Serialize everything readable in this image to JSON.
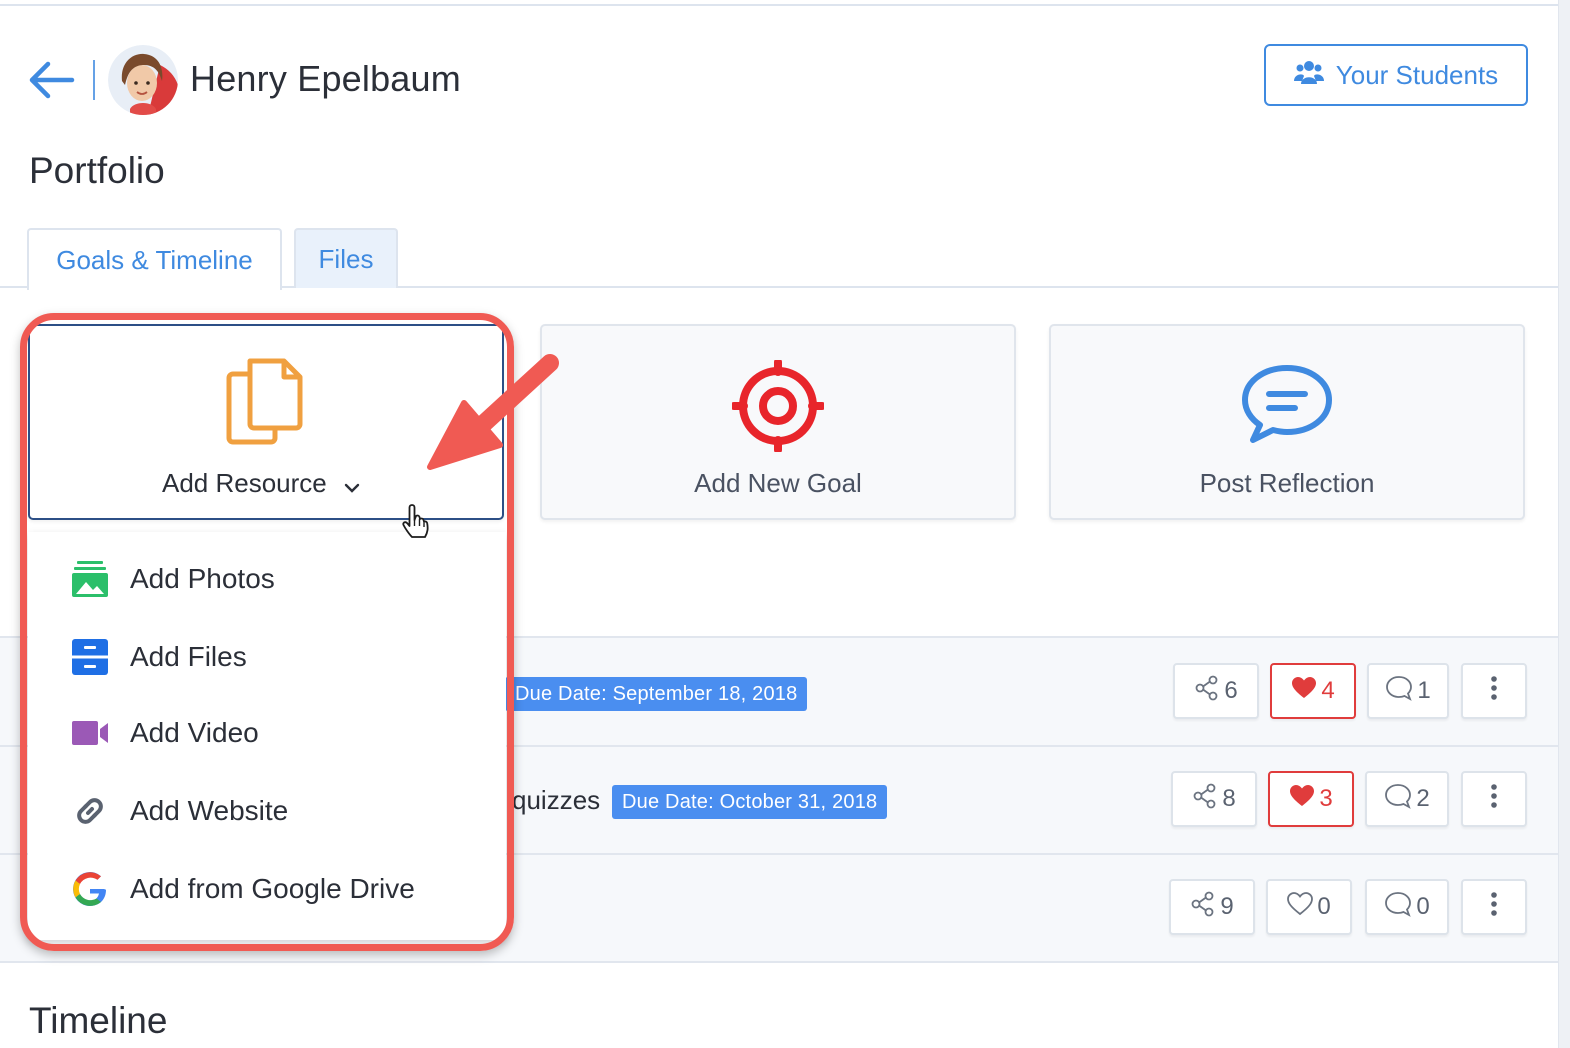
{
  "header": {
    "student_name": "Henry Epelbaum",
    "your_students_label": "Your Students"
  },
  "page_title": "Portfolio",
  "tabs": [
    {
      "label": "Goals & Timeline",
      "active": true
    },
    {
      "label": "Files",
      "active": false
    }
  ],
  "actions": {
    "add_resource": "Add Resource",
    "add_goal": "Add New Goal",
    "post_reflection": "Post Reflection"
  },
  "resource_menu": [
    {
      "label": "Add Photos",
      "icon": "photos-icon"
    },
    {
      "label": "Add Files",
      "icon": "files-icon"
    },
    {
      "label": "Add Video",
      "icon": "video-icon"
    },
    {
      "label": "Add Website",
      "icon": "link-icon"
    },
    {
      "label": "Add from Google Drive",
      "icon": "google-drive-icon"
    }
  ],
  "goals": [
    {
      "title_fragment": "",
      "due": "Due Date: September 18, 2018",
      "shares": "6",
      "likes": "4",
      "liked": true,
      "comments": "1"
    },
    {
      "title_fragment": "quizzes",
      "due": "Due Date: October 31, 2018",
      "shares": "8",
      "likes": "3",
      "liked": true,
      "comments": "2"
    },
    {
      "title_fragment": "",
      "due": "",
      "shares": "9",
      "likes": "0",
      "liked": false,
      "comments": "0"
    }
  ],
  "timeline_title": "Timeline",
  "colors": {
    "accent": "#3f8ae0",
    "badge": "#4a8ef0",
    "like": "#e03c3c",
    "annotation": "#f05a53",
    "goal_icon": "#e8252b",
    "resource_icon": "#f0a040"
  }
}
